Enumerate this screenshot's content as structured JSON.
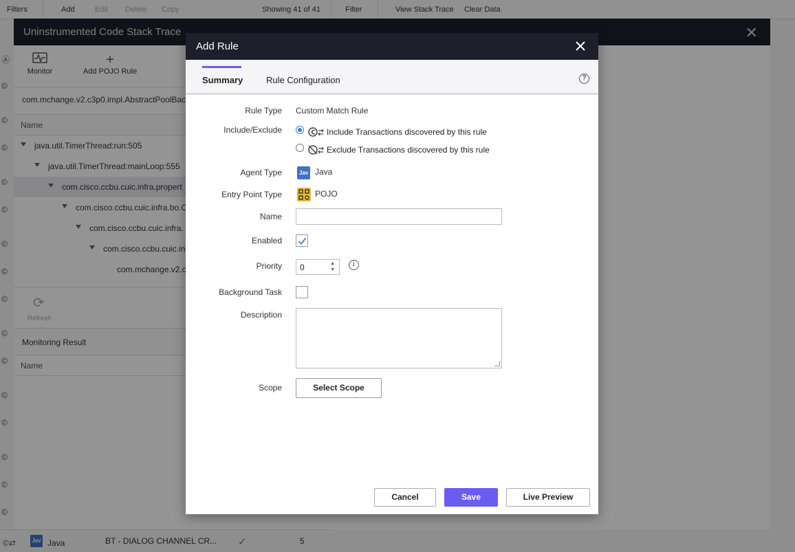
{
  "background": {
    "toolbar": {
      "filters": "Filters",
      "add": "Add",
      "edit": "Edit",
      "delete": "Delete",
      "copy": "Copy",
      "showing": "Showing 41 of 41",
      "filter": "Filter",
      "view_stack_trace": "View Stack Trace",
      "clear_data": "Clear Data"
    },
    "bottom_row": {
      "agent": "Java",
      "agent_badge": "Jav",
      "name": "BT - DIALOG CHANNEL CR...",
      "count": "5"
    }
  },
  "stack_trace": {
    "title": "Uninstrumented Code Stack Trace",
    "tools": {
      "monitor": "Monitor",
      "add_pojo_rule": "Add POJO Rule"
    },
    "path": "com.mchange.v2.c3p0.impl.AbstractPoolBac",
    "name_header": "Name",
    "tree": [
      "java.util.TimerThread:run:505",
      "java.util.TimerThread:mainLoop:555",
      "com.cisco.ccbu.cuic.infra.propert",
      "com.cisco.ccbu.cuic.infra.bo.C",
      "com.cisco.ccbu.cuic.infra.",
      "com.cisco.ccbu.cuic.in",
      "com.mchange.v2.c"
    ],
    "refresh": "Refresh",
    "monitoring_result": "Monitoring Result",
    "mon_name_header": "Name"
  },
  "dialog": {
    "title": "Add Rule",
    "tabs": [
      {
        "label": "Summary",
        "active": true
      },
      {
        "label": "Rule Configuration",
        "active": false
      }
    ],
    "fields": {
      "rule_type_label": "Rule Type",
      "rule_type_value": "Custom Match Rule",
      "include_exclude_label": "Include/Exclude",
      "include_option": "Include Transactions discovered by this rule",
      "exclude_option": "Exclude Transactions discovered by this rule",
      "include_selected": true,
      "agent_type_label": "Agent Type",
      "agent_type_value": "Java",
      "agent_badge": "Jav",
      "entry_point_label": "Entry Point Type",
      "entry_point_value": "POJO",
      "name_label": "Name",
      "name_value": "",
      "enabled_label": "Enabled",
      "enabled": true,
      "priority_label": "Priority",
      "priority_value": "0",
      "background_task_label": "Background Task",
      "background_task": false,
      "description_label": "Description",
      "description_value": "",
      "scope_label": "Scope",
      "select_scope": "Select Scope"
    },
    "buttons": {
      "cancel": "Cancel",
      "save": "Save",
      "live_preview": "Live Preview"
    }
  },
  "colors": {
    "header_bg": "#1d1f2b",
    "accent": "#6b5cf0",
    "radio_blue": "#3b7be0",
    "java_badge": "#3f72c8",
    "pojo_badge": "#e8b93a"
  }
}
